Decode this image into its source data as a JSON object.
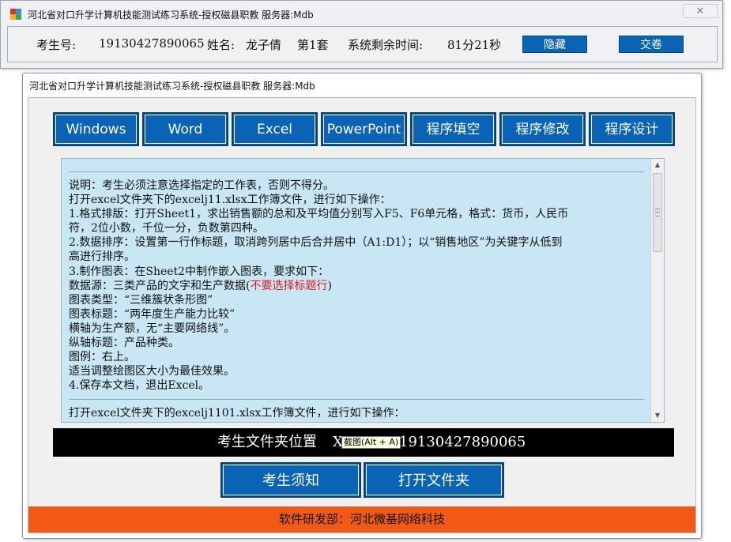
{
  "status_window": {
    "title": "河北省对口升学计算机技能测试练习系统-授权磁县职教  服务器:Mdb",
    "close_label": "✕",
    "exam_id_label": "考生号:",
    "exam_id": "19130427890065",
    "name_label": "姓名:",
    "name": "龙子倩",
    "set": "第1套",
    "time_label": "系统剩余时间:",
    "time_left": "81分21秒",
    "hide_button": "隐藏",
    "submit_button": "交卷"
  },
  "main_window": {
    "title": "河北省对口升学计算机技能测试练习系统-授权磁县职教  服务器:Mdb",
    "tabs": [
      "Windows",
      "Word",
      "Excel",
      "PowerPoint",
      "程序填空",
      "程序修改",
      "程序设计"
    ],
    "instructions": {
      "lines": [
        "说明：考生必须注意选择指定的工作表，否则不得分。",
        "打开excel文件夹下的excelj11.xlsx工作簿文件，进行如下操作：",
        "1.格式排版：打开Sheet1，求出销售额的总和及平均值分别写入F5、F6单元格，格式：货币，人民币",
        "符，2位小数，千位一分，负数第四种。",
        "2.数据排序：设置第一行作标题，取消跨列居中后合并居中（A1:D1）；以“销售地区”为关键字从低到",
        "高进行排序。",
        "3.制作图表：在Sheet2中制作嵌入图表，要求如下：",
        "图表类型：“三维簇状条形图”",
        "图表标题：“两年度生产能力比较”",
        "横轴为生产额，无“主要网络线”。",
        "纵轴标题：产品种类。",
        "图例：右上。",
        "适当调整绘图区大小为最佳效果。",
        "4.保存本文档，退出Excel。"
      ],
      "data_source_prefix": "数据源：三类产品的文字和生产数据(",
      "data_source_red": "不要选择标题行",
      "data_source_suffix": ")",
      "next_line": "打开excel文件夹下的excelj1101.xlsx工作簿文件，进行如下操作："
    },
    "path_label": "考生文件夹位置",
    "path_prefix": "X",
    "path_value": "19130427890065",
    "tooltip": "截图(Alt + A)",
    "notice_button": "考生须知",
    "open_folder_button": "打开文件夹",
    "footer": "软件研发部：河北微基网络科技"
  },
  "colors": {
    "button_blue": "#0b63b6",
    "footer_orange": "#f05a14",
    "instruction_bg": "#c8e6f3",
    "highlight_red": "#e02020"
  }
}
